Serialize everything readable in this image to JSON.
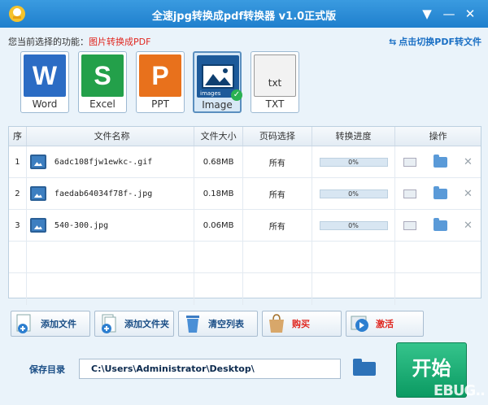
{
  "window": {
    "title": "全速jpg转换成pdf转换器 v1.0正式版",
    "menu_glyph": "▼",
    "minimize_glyph": "—",
    "close_glyph": "✕"
  },
  "function_bar": {
    "prefix": "您当前选择的功能：",
    "selected": "图片转换成PDF",
    "switch_label": "点击切换PDF转文件"
  },
  "formats": [
    {
      "label": "Word",
      "glyph": "W",
      "color": "#2b6cc4"
    },
    {
      "label": "Excel",
      "glyph": "S",
      "color": "#23a04a"
    },
    {
      "label": "PPT",
      "glyph": "P",
      "color": "#e8711c"
    },
    {
      "label": "Image",
      "glyph": "",
      "color": "#1d5a9a",
      "badge": "images",
      "selected": true
    },
    {
      "label": "TXT",
      "glyph": "txt",
      "color": "#d8d8d8"
    }
  ],
  "table": {
    "headers": {
      "index": "序",
      "name": "文件名称",
      "size": "文件大小",
      "pages": "页码选择",
      "progress": "转换进度",
      "actions": "操作"
    },
    "rows": [
      {
        "index": "1",
        "name": "6adc108fjw1ewkc-.gif",
        "size": "0.68MB",
        "pages": "所有",
        "progress": "0%"
      },
      {
        "index": "2",
        "name": "faedab64034f78f-.jpg",
        "size": "0.18MB",
        "pages": "所有",
        "progress": "0%"
      },
      {
        "index": "3",
        "name": "540-300.jpg",
        "size": "0.06MB",
        "pages": "所有",
        "progress": "0%"
      }
    ]
  },
  "buttons": {
    "add_file": "添加文件",
    "add_folder": "添加文件夹",
    "clear_list": "清空列表",
    "buy": "购买",
    "activate": "激活",
    "start": "开始"
  },
  "save": {
    "label": "保存目录",
    "path": "C:\\Users\\Administrator\\Desktop\\"
  },
  "watermark": "EBUG.."
}
